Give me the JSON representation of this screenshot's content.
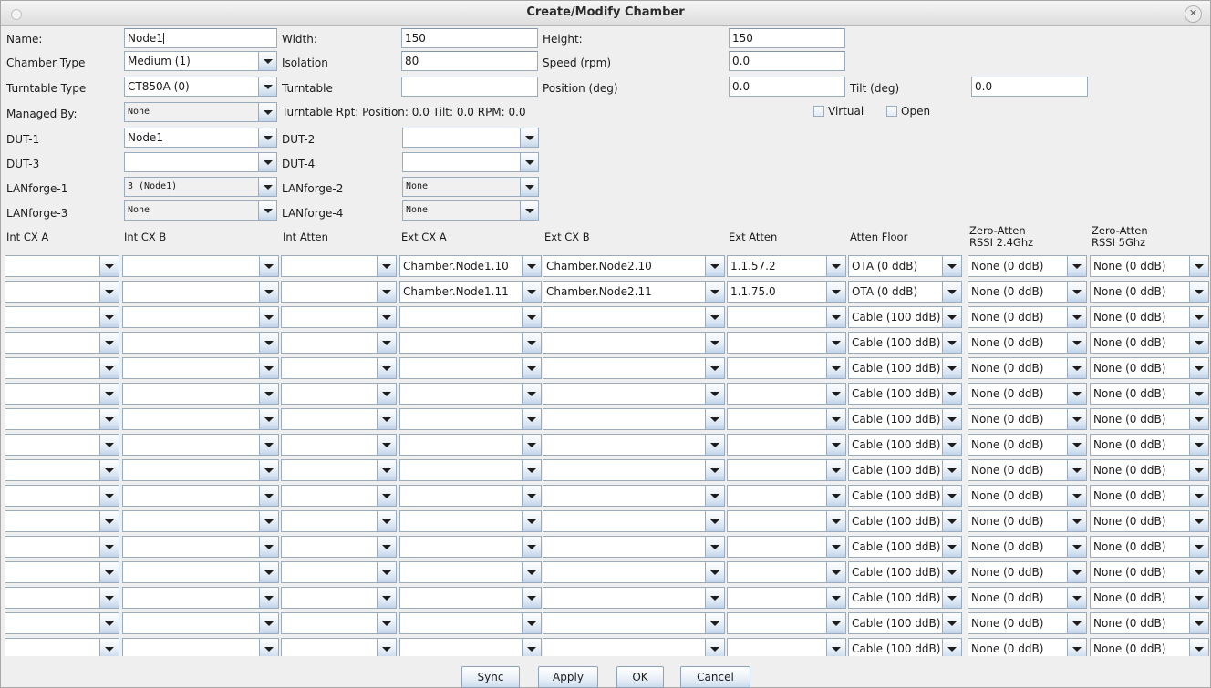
{
  "window": {
    "title": "Create/Modify Chamber",
    "close_label": "✕"
  },
  "form": {
    "name_label": "Name:",
    "name_value": "Node1",
    "width_label": "Width:",
    "width_value": "150",
    "height_label": "Height:",
    "height_value": "150",
    "chamber_type_label": "Chamber Type",
    "chamber_type_value": "Medium (1)",
    "isolation_label": "Isolation",
    "isolation_value": "80",
    "speed_label": "Speed (rpm)",
    "speed_value": "0.0",
    "turntable_type_label": "Turntable Type",
    "turntable_type_value": "CT850A (0)",
    "turntable_label": "Turntable",
    "turntable_value": "",
    "position_label": "Position (deg)",
    "position_value": "0.0",
    "tilt_label": "Tilt (deg)",
    "tilt_value": "0.0",
    "managed_by_label": "Managed By:",
    "managed_by_value": "None",
    "turntable_rpt": "Turntable Rpt: Position: 0.0 Tilt: 0.0 RPM: 0.0",
    "virtual_label": "Virtual",
    "open_label": "Open",
    "dut1_label": "DUT-1",
    "dut1_value": "Node1",
    "dut2_label": "DUT-2",
    "dut2_value": "",
    "dut3_label": "DUT-3",
    "dut3_value": "",
    "dut4_label": "DUT-4",
    "dut4_value": "",
    "lanforge1_label": "LANforge-1",
    "lanforge1_value": "3 (Node1)",
    "lanforge2_label": "LANforge-2",
    "lanforge2_value": "None",
    "lanforge3_label": "LANforge-3",
    "lanforge3_value": "None",
    "lanforge4_label": "LANforge-4",
    "lanforge4_value": "None"
  },
  "table": {
    "columns": [
      {
        "label": "Int CX A"
      },
      {
        "label": "Int CX B"
      },
      {
        "label": "Int Atten"
      },
      {
        "label": "Ext CX A"
      },
      {
        "label": "Ext CX B"
      },
      {
        "label": "Ext Atten"
      },
      {
        "label": "Atten Floor"
      },
      {
        "label": "Zero-Atten\nRSSI 2.4Ghz",
        "line1": "Zero-Atten",
        "line2": "RSSI 2.4Ghz"
      },
      {
        "label": "Zero-Atten\nRSSI 5Ghz",
        "line1": "Zero-Atten",
        "line2": "RSSI 5Ghz"
      }
    ],
    "rows": [
      {
        "int_cx_a": "",
        "int_cx_b": "",
        "int_atten": "",
        "ext_cx_a": "Chamber.Node1.10",
        "ext_cx_b": "Chamber.Node2.10",
        "ext_atten": "1.1.57.2",
        "atten_floor": "OTA (0 ddB)",
        "zero_24": "None (0 ddB)",
        "zero_5": "None (0 ddB)"
      },
      {
        "int_cx_a": "",
        "int_cx_b": "",
        "int_atten": "",
        "ext_cx_a": "Chamber.Node1.11",
        "ext_cx_b": "Chamber.Node2.11",
        "ext_atten": "1.1.75.0",
        "atten_floor": "OTA (0 ddB)",
        "zero_24": "None (0 ddB)",
        "zero_5": "None (0 ddB)"
      },
      {
        "int_cx_a": "",
        "int_cx_b": "",
        "int_atten": "",
        "ext_cx_a": "",
        "ext_cx_b": "",
        "ext_atten": "",
        "atten_floor": "Cable (100 ddB)",
        "zero_24": "None (0 ddB)",
        "zero_5": "None (0 ddB)"
      },
      {
        "int_cx_a": "",
        "int_cx_b": "",
        "int_atten": "",
        "ext_cx_a": "",
        "ext_cx_b": "",
        "ext_atten": "",
        "atten_floor": "Cable (100 ddB)",
        "zero_24": "None (0 ddB)",
        "zero_5": "None (0 ddB)"
      },
      {
        "int_cx_a": "",
        "int_cx_b": "",
        "int_atten": "",
        "ext_cx_a": "",
        "ext_cx_b": "",
        "ext_atten": "",
        "atten_floor": "Cable (100 ddB)",
        "zero_24": "None (0 ddB)",
        "zero_5": "None (0 ddB)"
      },
      {
        "int_cx_a": "",
        "int_cx_b": "",
        "int_atten": "",
        "ext_cx_a": "",
        "ext_cx_b": "",
        "ext_atten": "",
        "atten_floor": "Cable (100 ddB)",
        "zero_24": "None (0 ddB)",
        "zero_5": "None (0 ddB)"
      },
      {
        "int_cx_a": "",
        "int_cx_b": "",
        "int_atten": "",
        "ext_cx_a": "",
        "ext_cx_b": "",
        "ext_atten": "",
        "atten_floor": "Cable (100 ddB)",
        "zero_24": "None (0 ddB)",
        "zero_5": "None (0 ddB)"
      },
      {
        "int_cx_a": "",
        "int_cx_b": "",
        "int_atten": "",
        "ext_cx_a": "",
        "ext_cx_b": "",
        "ext_atten": "",
        "atten_floor": "Cable (100 ddB)",
        "zero_24": "None (0 ddB)",
        "zero_5": "None (0 ddB)"
      },
      {
        "int_cx_a": "",
        "int_cx_b": "",
        "int_atten": "",
        "ext_cx_a": "",
        "ext_cx_b": "",
        "ext_atten": "",
        "atten_floor": "Cable (100 ddB)",
        "zero_24": "None (0 ddB)",
        "zero_5": "None (0 ddB)"
      },
      {
        "int_cx_a": "",
        "int_cx_b": "",
        "int_atten": "",
        "ext_cx_a": "",
        "ext_cx_b": "",
        "ext_atten": "",
        "atten_floor": "Cable (100 ddB)",
        "zero_24": "None (0 ddB)",
        "zero_5": "None (0 ddB)"
      },
      {
        "int_cx_a": "",
        "int_cx_b": "",
        "int_atten": "",
        "ext_cx_a": "",
        "ext_cx_b": "",
        "ext_atten": "",
        "atten_floor": "Cable (100 ddB)",
        "zero_24": "None (0 ddB)",
        "zero_5": "None (0 ddB)"
      },
      {
        "int_cx_a": "",
        "int_cx_b": "",
        "int_atten": "",
        "ext_cx_a": "",
        "ext_cx_b": "",
        "ext_atten": "",
        "atten_floor": "Cable (100 ddB)",
        "zero_24": "None (0 ddB)",
        "zero_5": "None (0 ddB)"
      },
      {
        "int_cx_a": "",
        "int_cx_b": "",
        "int_atten": "",
        "ext_cx_a": "",
        "ext_cx_b": "",
        "ext_atten": "",
        "atten_floor": "Cable (100 ddB)",
        "zero_24": "None (0 ddB)",
        "zero_5": "None (0 ddB)"
      },
      {
        "int_cx_a": "",
        "int_cx_b": "",
        "int_atten": "",
        "ext_cx_a": "",
        "ext_cx_b": "",
        "ext_atten": "",
        "atten_floor": "Cable (100 ddB)",
        "zero_24": "None (0 ddB)",
        "zero_5": "None (0 ddB)"
      },
      {
        "int_cx_a": "",
        "int_cx_b": "",
        "int_atten": "",
        "ext_cx_a": "",
        "ext_cx_b": "",
        "ext_atten": "",
        "atten_floor": "Cable (100 ddB)",
        "zero_24": "None (0 ddB)",
        "zero_5": "None (0 ddB)"
      },
      {
        "int_cx_a": "",
        "int_cx_b": "",
        "int_atten": "",
        "ext_cx_a": "",
        "ext_cx_b": "",
        "ext_atten": "",
        "atten_floor": "Cable (100 ddB)",
        "zero_24": "None (0 ddB)",
        "zero_5": "None (0 ddB)"
      }
    ]
  },
  "buttons": {
    "sync": "Sync",
    "apply": "Apply",
    "ok": "OK",
    "cancel": "Cancel"
  },
  "colors": {
    "window_bg": "#efefef",
    "field_border": "#9aabbd",
    "titlebar_top": "#f6f6f6",
    "button_face": "#dbe6f3"
  }
}
